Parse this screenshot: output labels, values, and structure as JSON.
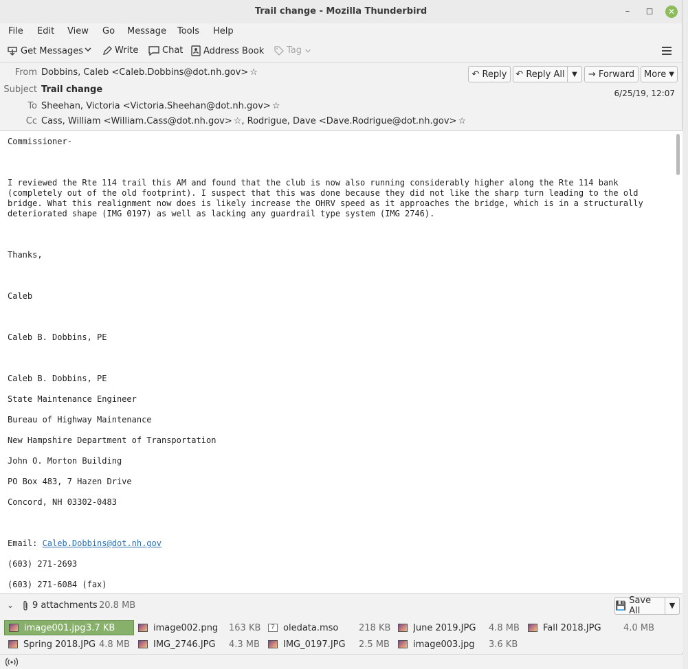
{
  "window": {
    "title": "Trail change - Mozilla Thunderbird"
  },
  "menu": [
    "File",
    "Edit",
    "View",
    "Go",
    "Message",
    "Tools",
    "Help"
  ],
  "toolbar": {
    "get_messages": "Get Messages",
    "write": "Write",
    "chat": "Chat",
    "address_book": "Address Book",
    "tag": "Tag"
  },
  "header": {
    "from_label": "From",
    "from_value": "Dobbins, Caleb <Caleb.Dobbins@dot.nh.gov>",
    "subject_label": "Subject",
    "subject_value": "Trail change",
    "to_label": "To",
    "to_value": "Sheehan, Victoria <Victoria.Sheehan@dot.nh.gov>",
    "cc_label": "Cc",
    "cc_value_1": "Cass, William <William.Cass@dot.nh.gov>",
    "cc_value_2": "Rodrigue, Dave <Dave.Rodrigue@dot.nh.gov>",
    "date": "6/25/19, 12:07",
    "reply": "Reply",
    "reply_all": "Reply All",
    "forward": "Forward",
    "more": "More"
  },
  "body": {
    "greeting": "Commissioner-",
    "para_1": "I reviewed the Rte 114 trail this AM and found that the club is now also running considerably higher along the Rte 114 bank",
    "para_2": "(completely out of the old footprint).  I suspect that this was done because they did not like the sharp turn leading to the old",
    "para_3": "bridge.  What this realignment now does is likely increase the OHRV speed as it approaches the bridge, which is in a structurally",
    "para_4": "deteriorated shape (IMG 0197) as well as lacking any guardrail type system (IMG 2746).",
    "thanks": "Thanks,",
    "signoff": "Caleb",
    "name_1": "Caleb B. Dobbins, PE",
    "name_2": "Caleb B. Dobbins, PE",
    "title": "State Maintenance Engineer",
    "bureau": "Bureau of Highway Maintenance",
    "department": "New Hampshire Department of Transportation",
    "building": "John O. Morton Building",
    "address": "PO Box 483, 7 Hazen Drive",
    "city": "Concord, NH 03302-0483",
    "email_label": "Email: ",
    "email": "Caleb.Dobbins@dot.nh.gov",
    "phone": "(603) 271-2693",
    "fax": "(603) 271-6084 (fax)"
  },
  "attachments": {
    "count_label": "9 attachments",
    "total_size": "20.8 MB",
    "save_all": "Save All",
    "items": [
      {
        "name": "image001.jpg",
        "size": "3.7 KB"
      },
      {
        "name": "image002.png",
        "size": "163 KB"
      },
      {
        "name": "oledata.mso",
        "size": "218 KB"
      },
      {
        "name": "June 2019.JPG",
        "size": "4.8 MB"
      },
      {
        "name": "Fall 2018.JPG",
        "size": "4.0 MB"
      },
      {
        "name": "Spring 2018.JPG",
        "size": "4.8 MB"
      },
      {
        "name": "IMG_2746.JPG",
        "size": "4.3 MB"
      },
      {
        "name": "IMG_0197.JPG",
        "size": "2.5 MB"
      },
      {
        "name": "image003.jpg",
        "size": "3.6 KB"
      }
    ]
  }
}
